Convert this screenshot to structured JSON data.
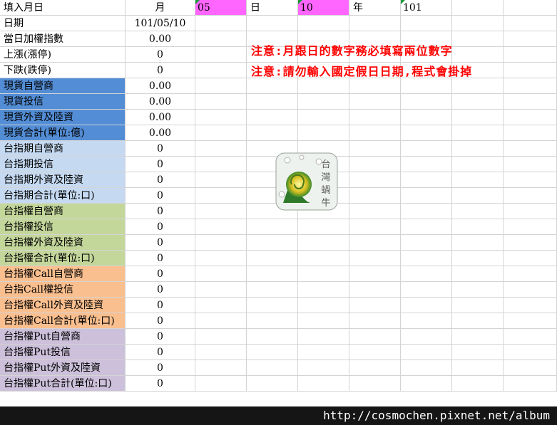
{
  "header": {
    "title": "填入月日",
    "month_label": "月",
    "month_value": "05",
    "day_label": "日",
    "day_value": "10",
    "year_label": "年",
    "year_value": "101"
  },
  "notes": [
    "注意:月跟日的數字務必填寫兩位數字",
    "注意:請勿輸入國定假日日期,程式會掛掉"
  ],
  "rows": [
    {
      "label": "日期",
      "value": "101/05/10",
      "group": "plain"
    },
    {
      "label": "當日加權指數",
      "value": "0.00",
      "group": "plain"
    },
    {
      "label": "上漲(漲停)",
      "value": "0",
      "group": "plain"
    },
    {
      "label": "下跌(跌停)",
      "value": "0",
      "group": "plain"
    },
    {
      "label": "現貨自營商",
      "value": "0.00",
      "group": "spot"
    },
    {
      "label": "現貨投信",
      "value": "0.00",
      "group": "spot"
    },
    {
      "label": "現貨外資及陸資",
      "value": "0.00",
      "group": "spot"
    },
    {
      "label": "現貨合計(單位:億)",
      "value": "0.00",
      "group": "spot"
    },
    {
      "label": "台指期自營商",
      "value": "0",
      "group": "futures"
    },
    {
      "label": "台指期投信",
      "value": "0",
      "group": "futures"
    },
    {
      "label": "台指期外資及陸資",
      "value": "0",
      "group": "futures"
    },
    {
      "label": "台指期合計(單位:口)",
      "value": "0",
      "group": "futures"
    },
    {
      "label": "台指權自營商",
      "value": "0",
      "group": "options"
    },
    {
      "label": "台指權投信",
      "value": "0",
      "group": "options"
    },
    {
      "label": "台指權外資及陸資",
      "value": "0",
      "group": "options"
    },
    {
      "label": "台指權合計(單位:口)",
      "value": "0",
      "group": "options"
    },
    {
      "label": "台指權Call自營商",
      "value": "0",
      "group": "call"
    },
    {
      "label": "台指Call權投信",
      "value": "0",
      "group": "call"
    },
    {
      "label": "台指權Call外資及陸資",
      "value": "0",
      "group": "call"
    },
    {
      "label": "台指權Call合計(單位:口)",
      "value": "0",
      "group": "call"
    },
    {
      "label": "台指權Put自營商",
      "value": "0",
      "group": "put"
    },
    {
      "label": "台指權Put投信",
      "value": "0",
      "group": "put"
    },
    {
      "label": "台指權Put外資及陸資",
      "value": "0",
      "group": "put"
    },
    {
      "label": "台指權Put合計(單位:口)",
      "value": "0",
      "group": "put"
    }
  ],
  "group_colors": {
    "plain": "#ffffff",
    "spot": "#538dd5",
    "futures": "#c5d9f1",
    "options": "#c4d79b",
    "call": "#fabf8f",
    "put": "#ccc0da"
  },
  "watermark": {
    "logo_text": "台灣蝸牛",
    "logo_icon": "snail-logo-icon"
  },
  "footer": {
    "url": "http://cosmochen.pixnet.net/album"
  }
}
